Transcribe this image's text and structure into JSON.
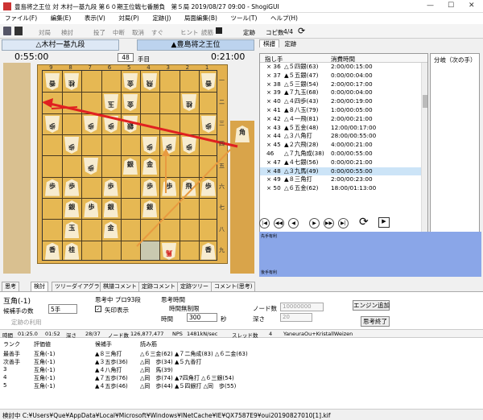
{
  "title": "豊島将之王位 対 木村一基九段 第６０期王位戦七番勝負　第５局 2019/08/27 09:00 - ShogiGUI",
  "menu": [
    "ファイル(F)",
    "編集(E)",
    "表示(V)",
    "対局(P)",
    "定跡(J)",
    "局面編集(B)",
    "ツール(T)",
    "ヘルプ(H)"
  ],
  "toolbar": {
    "taikyoku": "対局",
    "kento": "検討",
    "toryo": "投了",
    "chudan": "中断",
    "torikeshi": "取消",
    "sugu": "すぐ",
    "hint": "ヒント",
    "yomisuji": "読筋",
    "joseki": "定跡",
    "copy": "コピ数",
    "count": "4/4"
  },
  "players": {
    "gote": "△木村一基九段",
    "sente": "▲豊島将之王位",
    "gote_time": "0:55:00",
    "sente_time": "0:21:00",
    "move_no": "48",
    "move_unit": "手目"
  },
  "files": [
    "9",
    "8",
    "7",
    "6",
    "5",
    "4",
    "3",
    "2",
    "1"
  ],
  "ranks": [
    "一",
    "二",
    "三",
    "四",
    "五",
    "六",
    "七",
    "八",
    "九"
  ],
  "kifu": {
    "tabs": [
      "棋譜",
      "定跡"
    ],
    "header_move": "指し手",
    "header_time": "消費時間",
    "branch_header": "分岐（次の手）",
    "rows": [
      [
        "× 36",
        "△５四銀(63)",
        "2:00/00:15:00"
      ],
      [
        "× 37",
        "▲５五銀(47)",
        "0:00/00:04:00"
      ],
      [
        "× 38",
        "△５三銀(54)",
        "2:00/00:17:00"
      ],
      [
        "× 39",
        "▲７九玉(68)",
        "0:00/00:04:00"
      ],
      [
        "× 40",
        "△４四歩(43)",
        "2:00/00:19:00"
      ],
      [
        "× 41",
        "▲８八玉(79)",
        "1:00/00:05:00"
      ],
      [
        "× 42",
        "△４一飛(81)",
        "2:00/00:21:00"
      ],
      [
        "× 43",
        "▲５五金(48)",
        "12:00/00:17:00"
      ],
      [
        "× 44",
        "△３八角打",
        "28:00/00:55:00"
      ],
      [
        "× 45",
        "▲２六飛(28)",
        "4:00/00:21:00"
      ],
      [
        "  46",
        "△７九角成(38)",
        "0:00/00:55:00"
      ],
      [
        "× 47",
        "▲４七銀(56)",
        "0:00/00:21:00"
      ],
      [
        "× 48",
        "△３九馬(49)",
        "0:00/00:55:00"
      ],
      [
        "× 49",
        "▲８三角打",
        "2:00/00:23:00"
      ],
      [
        "× 50",
        "△６五金(62)",
        "18:00/01:13:00"
      ]
    ],
    "selected": 12
  },
  "graph": {
    "label_top": "先手有利",
    "label_bottom": "後手有利"
  },
  "bottom_tabs": [
    "思考",
    "検討",
    "ツリーダイアグラム",
    "棋譜コメント",
    "定跡コメント",
    "定跡ツリー",
    "コメント(思考)"
  ],
  "engine": {
    "eval": "互角(-1)",
    "candidates_label": "候補手の数",
    "candidates_value": "5手",
    "teiseki": "定跡の利用",
    "thinking": "思考中 プロ93段",
    "arrow": "矢印表示",
    "time_label": "思考時間",
    "unlimited": "時間無制限",
    "nodes": "ノード数",
    "nodes_value": "10000000",
    "time": "時間",
    "time_value": "300",
    "sec": "秒",
    "depth": "深さ",
    "depth_value": "20",
    "add_engine": "エンジン追加",
    "stop": "思考終了",
    "stats": [
      "時間",
      "01:25.0",
      "01:52",
      "深さ",
      "28/37",
      "ノード数",
      "126,877,477",
      "NPS",
      "1481kN/sec",
      "スレッド数",
      "4",
      "YaneuraOu+KristallWeizen"
    ],
    "headers": [
      "ランク",
      "評価値",
      "候補手",
      "読み筋"
    ],
    "lines": [
      [
        "最善手",
        "互角(-1)",
        "▲８三角打",
        "△６三金(62) ▲７二角成(83) △６二金(63)"
      ],
      [
        "次善手",
        "互角(-1)",
        "▲３五歩(36)",
        "△同　歩(34) ▲５九香打"
      ],
      [
        "3",
        "互角(-1)",
        "▲４八角打",
        "△同　馬(39)"
      ],
      [
        "4",
        "互角(-1)",
        "▲７五歩(76)",
        "△同　歩(74) ▲7四角打 △６三銀(54)"
      ],
      [
        "5",
        "互角(-1)",
        "▲４五歩(46)",
        "△同　歩(44) ▲５四銀打 △同　歩(55)"
      ]
    ]
  },
  "status": "検討中  C:¥Users¥Que¥AppData¥Local¥Microsoft¥Windows¥INetCache¥IE¥QX7587E9¥oui20190827010[1].kif",
  "board": {
    "pieces": [
      {
        "f": 9,
        "r": 1,
        "p": "香",
        "g": true
      },
      {
        "f": 8,
        "r": 1,
        "p": "桂",
        "g": true
      },
      {
        "f": 5,
        "r": 1,
        "p": "金",
        "g": true
      },
      {
        "f": 4,
        "r": 1,
        "p": "飛",
        "g": true
      },
      {
        "f": 1,
        "r": 1,
        "p": "香",
        "g": true
      },
      {
        "f": 6,
        "r": 2,
        "p": "玉",
        "g": true
      },
      {
        "f": 5,
        "r": 2,
        "p": "金",
        "g": true
      },
      {
        "f": 2,
        "r": 2,
        "p": "桂",
        "g": true
      },
      {
        "f": 9,
        "r": 3,
        "p": "歩",
        "g": true
      },
      {
        "f": 7,
        "r": 3,
        "p": "歩",
        "g": true
      },
      {
        "f": 6,
        "r": 3,
        "p": "歩",
        "g": true
      },
      {
        "f": 5,
        "r": 3,
        "p": "銀",
        "g": true
      },
      {
        "f": 1,
        "r": 3,
        "p": "歩",
        "g": true
      },
      {
        "f": 8,
        "r": 4,
        "p": "歩",
        "g": true
      },
      {
        "f": 4,
        "r": 4,
        "p": "歩",
        "g": true
      },
      {
        "f": 3,
        "r": 4,
        "p": "歩",
        "g": true
      },
      {
        "f": 2,
        "r": 4,
        "p": "歩",
        "g": true
      },
      {
        "f": 7,
        "r": 5,
        "p": "歩",
        "g": true
      },
      {
        "f": 5,
        "r": 5,
        "p": "銀",
        "g": false
      },
      {
        "f": 4,
        "r": 5,
        "p": "金",
        "g": false
      },
      {
        "f": 9,
        "r": 6,
        "p": "歩",
        "g": false
      },
      {
        "f": 8,
        "r": 6,
        "p": "歩",
        "g": false
      },
      {
        "f": 6,
        "r": 6,
        "p": "歩",
        "g": false
      },
      {
        "f": 4,
        "r": 6,
        "p": "歩",
        "g": false
      },
      {
        "f": 3,
        "r": 6,
        "p": "歩",
        "g": false
      },
      {
        "f": 2,
        "r": 6,
        "p": "飛",
        "g": false
      },
      {
        "f": 1,
        "r": 6,
        "p": "歩",
        "g": false
      },
      {
        "f": 8,
        "r": 7,
        "p": "銀",
        "g": false
      },
      {
        "f": 7,
        "r": 7,
        "p": "歩",
        "g": false
      },
      {
        "f": 6,
        "r": 7,
        "p": "銀",
        "g": false
      },
      {
        "f": 4,
        "r": 7,
        "p": "銀",
        "g": false
      },
      {
        "f": 8,
        "r": 8,
        "p": "玉",
        "g": false
      },
      {
        "f": 6,
        "r": 8,
        "p": "金",
        "g": false
      },
      {
        "f": 9,
        "r": 9,
        "p": "香",
        "g": false
      },
      {
        "f": 8,
        "r": 9,
        "p": "桂",
        "g": false
      },
      {
        "f": 3,
        "r": 9,
        "p": "馬",
        "g": true,
        "red": true
      },
      {
        "f": 1,
        "r": 9,
        "p": "香",
        "g": false
      }
    ]
  }
}
